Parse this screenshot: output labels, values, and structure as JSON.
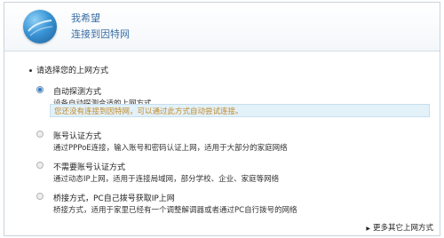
{
  "header": {
    "title": "我希望",
    "subtitle": "连接到因特网"
  },
  "prompt": "请选择您的上网方式",
  "options": [
    {
      "title": "自动探测方式",
      "desc": "设备自动探测合适的上网方式",
      "selected": true
    },
    {
      "title": "账号认证方式",
      "desc": "通过PPPoE连接，输入账号和密码认证上网，适用于大部分的家庭网络",
      "selected": false
    },
    {
      "title": "不需要账号认证方式",
      "desc": "通过动态IP上网，适用于连接局域网，部分学校、企业、家庭等网络",
      "selected": false
    },
    {
      "title": "桥接方式，PC自己拨号获取IP上网",
      "desc": "桥接方式，适用于家里已经有一个调整解调器或者通过PC自行拨号的网络",
      "selected": false
    }
  ],
  "hint": "您还没有连接到因特网，可以通过此方式自动尝试连接。",
  "more_link": "更多其它上网方式",
  "colors": {
    "title_blue": "#3a6ea5",
    "hint_bg": "#e3f1f9",
    "hint_text": "#c08a2a"
  }
}
